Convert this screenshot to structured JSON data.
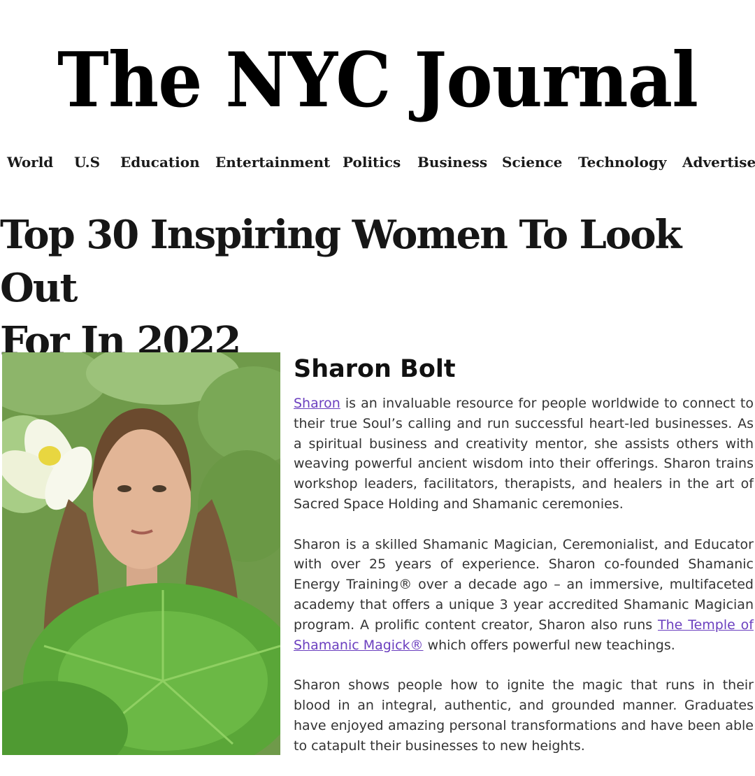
{
  "site": {
    "title": "The NYC Journal"
  },
  "nav": {
    "items": [
      "World",
      "U.S",
      "Education",
      "Entertainment",
      "Politics",
      "Business",
      "Science",
      "Technology",
      "Advertise"
    ]
  },
  "article": {
    "title_line1": "Top 30 Inspiring Women To Look Out",
    "title_line2": "For In 2022"
  },
  "profile": {
    "name": "Sharon Bolt",
    "p1_link": "Sharon",
    "p1_text": " is an invaluable resource for people worldwide to connect to their true Soul’s calling and run successful heart-led businesses. As a spiritual business and creativity mentor, she assists others with weaving powerful ancient wisdom into their offerings. Sharon trains workshop leaders, facilitators, therapists, and healers in the art of Sacred Space Holding and Shamanic ceremonies.",
    "p2_text_before": "Sharon is a skilled Shamanic Magician, Ceremonialist, and Educator with over 25 years of experience. Sharon co-founded Shamanic Energy Training® over a decade ago – an immersive, multifaceted academy that offers a unique 3 year accredited Shamanic Magician program. A prolific content creator, Sharon also runs ",
    "p2_link": "The Temple of Shamanic Magick®",
    "p2_text_after": " which offers powerful new teachings.",
    "p3_text": "Sharon shows people how to ignite the magic that runs in their blood in an integral, authentic, and grounded manner. Graduates have enjoyed amazing personal transformations and have been able to catapult their businesses to new heights."
  },
  "colors": {
    "link": "#6b3fbf",
    "foliage": "#5d8a3a"
  }
}
